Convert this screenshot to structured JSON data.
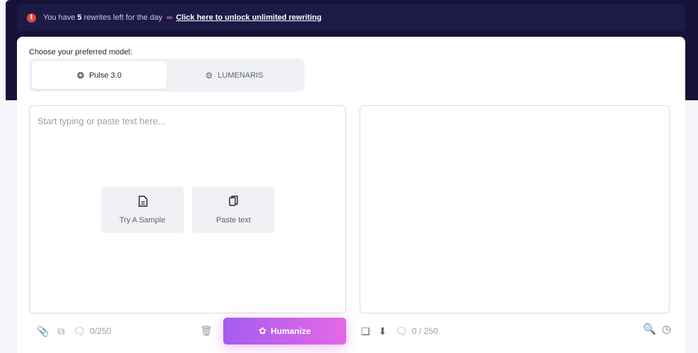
{
  "banner": {
    "prefix": "You have",
    "count": "5",
    "suffix": "rewrites left for the day",
    "link": "Click here to unlock unlimited rewriting"
  },
  "model": {
    "label": "Choose your preferred model:",
    "options": [
      {
        "label": "Pulse 3.0",
        "icon": "pulse-diamond-icon",
        "selected": true
      },
      {
        "label": "LUMENARIS",
        "icon": "brain-gear-icon",
        "selected": false
      }
    ]
  },
  "editor": {
    "placeholder": "Start typing or paste text here...",
    "actions": {
      "sample": "Try A Sample",
      "paste": "Paste text"
    },
    "counter": "0/250"
  },
  "humanize": {
    "label": "Humanize"
  },
  "output": {
    "counter": "0 / 250"
  },
  "colors": {
    "header_bg": "#16123a",
    "button_gradient_start": "#a45cf0",
    "button_gradient_end": "#e668e6",
    "info_red": "#e8483e",
    "accent_teal": "#2a9d8f"
  }
}
